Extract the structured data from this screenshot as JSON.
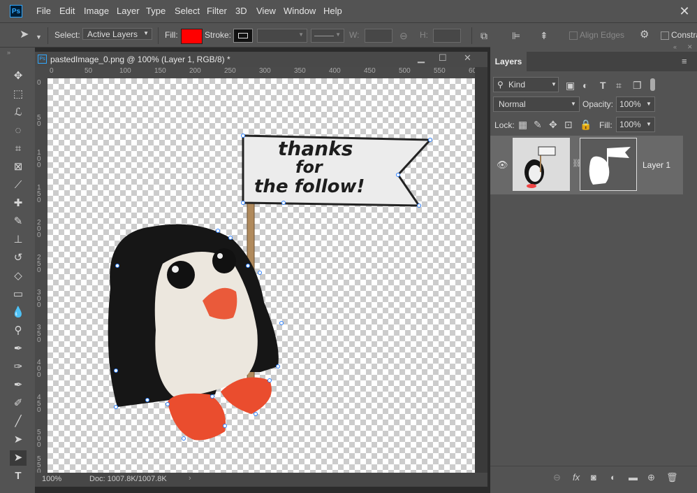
{
  "app": {
    "logo": "Ps"
  },
  "menu": [
    "File",
    "Edit",
    "Image",
    "Layer",
    "Type",
    "Select",
    "Filter",
    "3D",
    "View",
    "Window",
    "Help"
  ],
  "options": {
    "select_label": "Select:",
    "select_value": "Active Layers",
    "fill_label": "Fill:",
    "fill_color": "#ff0000",
    "stroke_label": "Stroke:",
    "w_label": "W:",
    "h_label": "H:",
    "align_edges": "Align Edges",
    "constrain": "Constra"
  },
  "document": {
    "title": "pastedImage_0.png @ 100% (Layer 1, RGB/8) *",
    "ruler_top": [
      "0",
      "50",
      "100",
      "150",
      "200",
      "250",
      "300",
      "350",
      "400",
      "450",
      "500",
      "550",
      "60"
    ],
    "ruler_left": [
      "0",
      "5\n0",
      "1\n0\n0",
      "1\n5\n0",
      "2\n0\n0",
      "2\n5\n0",
      "3\n0\n0",
      "3\n5\n0",
      "4\n0\n0",
      "4\n5\n0",
      "5\n0\n0",
      "5\n5\n0"
    ],
    "sign_text": [
      "thanks",
      "for",
      "the follow!"
    ],
    "zoom": "100%",
    "doc_info": "Doc: 1007.8K/1007.8K"
  },
  "layers_panel": {
    "tab": "Layers",
    "kind_filter": "Kind",
    "blend_mode": "Normal",
    "opacity_label": "Opacity:",
    "opacity_value": "100%",
    "lock_label": "Lock:",
    "fill_label": "Fill:",
    "fill_value": "100%",
    "layer_name": "Layer 1"
  },
  "icons": [
    "move-tool-icon",
    "marquee-icon",
    "lasso-icon",
    "quick-select-icon",
    "crop-icon",
    "frame-icon",
    "eyedropper-icon",
    "healing-icon",
    "brush-icon",
    "stamp-icon",
    "history-brush-icon",
    "eraser-icon",
    "gradient-icon",
    "blur-icon",
    "dodge-icon",
    "pen-icon",
    "freeform-pen-icon",
    "add-anchor-icon",
    "convert-anchor-icon",
    "path-select-icon",
    "direct-select-icon",
    "type-icon"
  ]
}
